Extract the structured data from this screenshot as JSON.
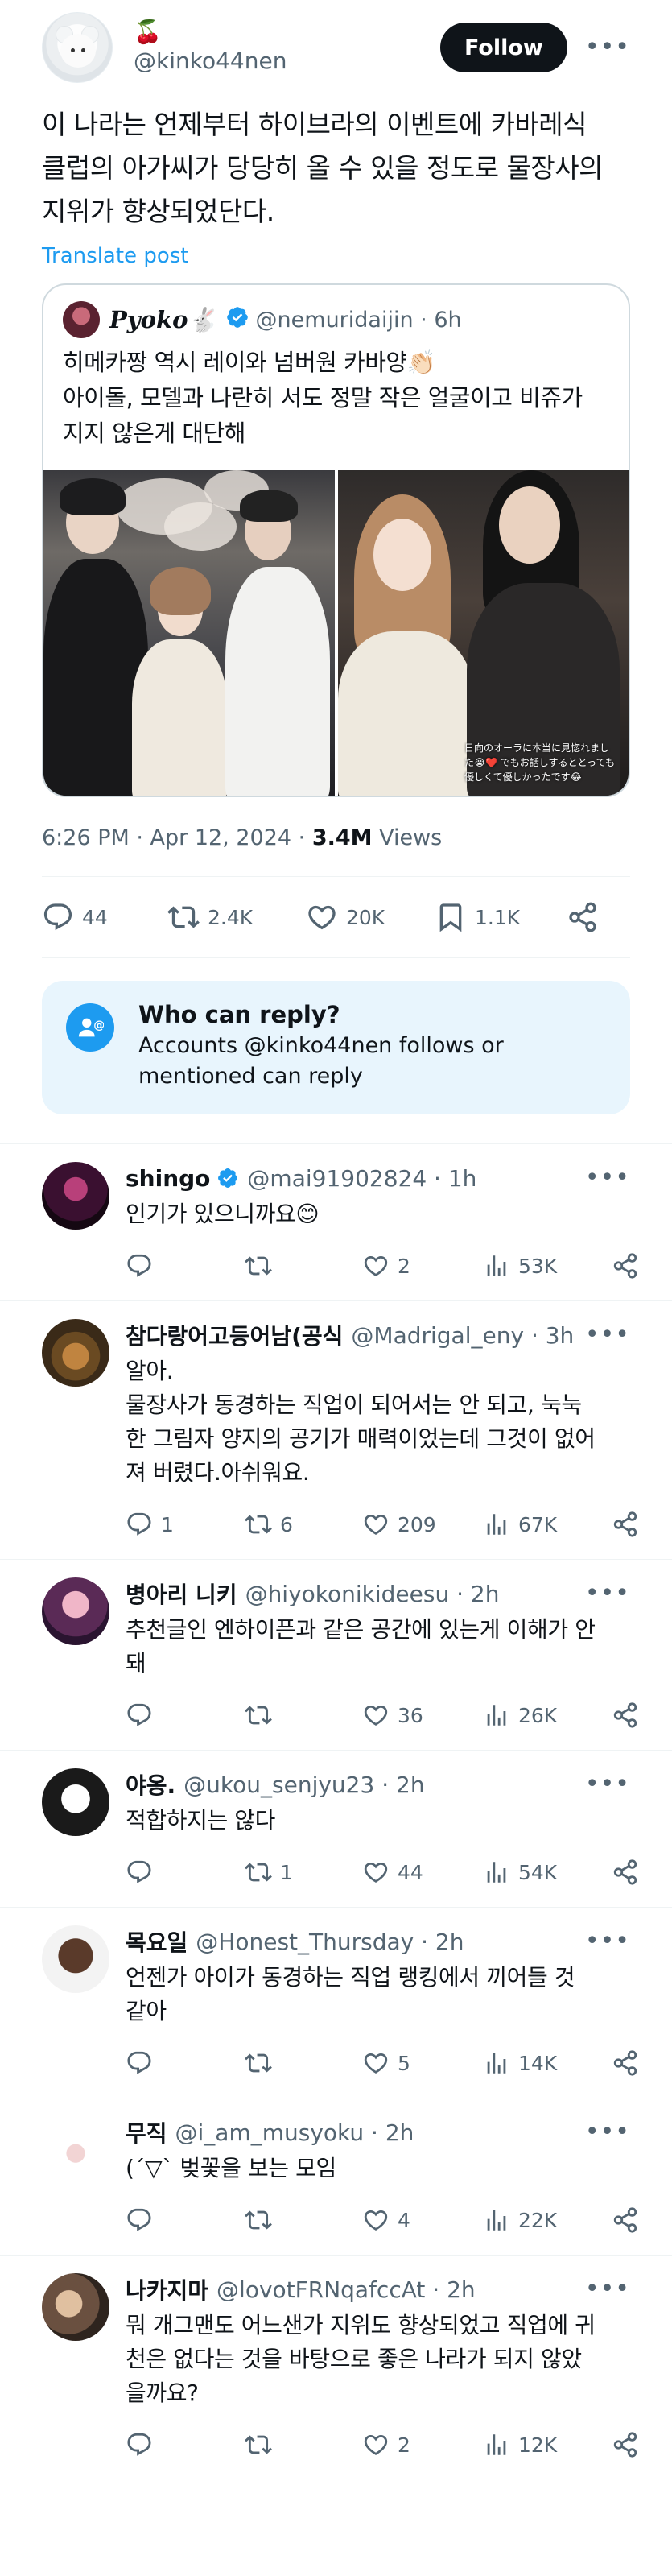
{
  "colors": {
    "accent": "#1d9bf0",
    "text": "#0f1419",
    "muted": "#536471",
    "verified": "#1d9bf0",
    "like": "#536471"
  },
  "main_tweet": {
    "display_name": "🍒",
    "handle": "@kinko44nen",
    "follow_label": "Follow",
    "more_icon": "more-dots-icon",
    "text_lines": [
      "이 나라는 언제부터 하이브라의 이벤트에 카바레식",
      "클럽의 아가씨가 당당히 올 수 있을 정도로 물장사의",
      "지위가 향상되었단다."
    ],
    "translate_label": "Translate post",
    "quote": {
      "name": "Pyoko🐇",
      "handle": "@nemuridaijin · 6h",
      "text_lines": [
        "히메카짱 역시 레이와 넘버원 카바양👏🏻",
        "아이돌, 모델과 나란히 서도 정말 작은 얼굴이고 비쥬가",
        "지지 않은게 대단해"
      ],
      "photo_caption": "日向のオーラに本当に見惚れました😭❤️ でもお話しするととっても優しくて優しかったです😂"
    },
    "time": "6:26 PM · Apr 12, 2024 · ",
    "views_count": "3.4M",
    "views_label": " Views",
    "stats": {
      "replies": "44",
      "reposts": "2.4K",
      "likes": "20K",
      "bookmarks": "1.1K"
    }
  },
  "who_can_reply": {
    "title": "Who can reply?",
    "desc_lines": [
      "Accounts @kinko44nen follows or",
      "mentioned can reply"
    ]
  },
  "replies": [
    {
      "name": "shingo",
      "verified": true,
      "handle": "@mai91902824 · 1h",
      "text_lines": [
        "인기가 있으니까요😊"
      ],
      "replies": "",
      "reposts": "",
      "likes": "2",
      "views": "53K"
    },
    {
      "name": "참다랑어고등어남(공식",
      "verified": false,
      "handle": "@Madrigal_eny · 3h",
      "text_lines": [
        "알아.",
        "물장사가 동경하는 직업이 되어서는 안 되고, 눅눅",
        "한 그림자 양지의 공기가 매력이었는데 그것이 없어",
        "져 버렸다.아쉬워요."
      ],
      "replies": "1",
      "reposts": "6",
      "likes": "209",
      "views": "67K"
    },
    {
      "name": "병아리 니키",
      "verified": false,
      "handle": "@hiyokonikideesu · 2h",
      "text_lines": [
        "추천글인 엔하이픈과 같은 공간에 있는게 이해가 안",
        "돼"
      ],
      "replies": "",
      "reposts": "",
      "likes": "36",
      "views": "26K"
    },
    {
      "name": "야옹.",
      "verified": false,
      "handle": "@ukou_senjyu23 · 2h",
      "text_lines": [
        "적합하지는 않다"
      ],
      "replies": "",
      "reposts": "1",
      "likes": "44",
      "views": "54K"
    },
    {
      "name": "목요일",
      "verified": false,
      "handle": "@Honest_Thursday · 2h",
      "text_lines": [
        "언젠가 아이가 동경하는 직업 랭킹에서 끼어들 것",
        "같아"
      ],
      "replies": "",
      "reposts": "",
      "likes": "5",
      "views": "14K"
    },
    {
      "name": "무직",
      "verified": false,
      "handle": "@i_am_musyoku · 2h",
      "text_lines": [
        "(´▽` 벚꽃을 보는 모임"
      ],
      "replies": "",
      "reposts": "",
      "likes": "4",
      "views": "22K"
    },
    {
      "name": "나카지마",
      "verified": false,
      "handle": "@lovotFRNqafccAt · 2h",
      "text_lines": [
        "뭐 개그맨도 어느샌가 지위도 향상되었고 직업에 귀",
        "천은 없다는 것을 바탕으로 좋은 나라가 되지 않았",
        "을까요?"
      ],
      "replies": "",
      "reposts": "",
      "likes": "2",
      "views": "12K"
    }
  ]
}
